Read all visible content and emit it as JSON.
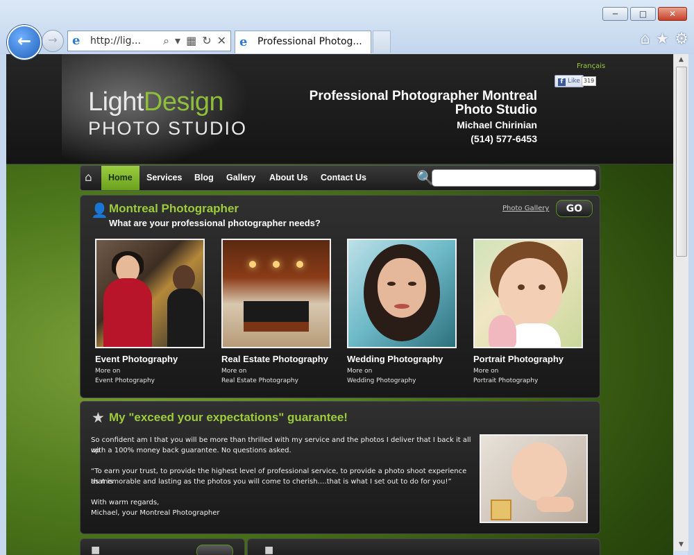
{
  "browser": {
    "address_url": "http://lig...",
    "tab_title": "Professional Photog...",
    "icons": [
      "back-icon",
      "forward-icon",
      "search-icon",
      "refresh-icon",
      "stop-icon",
      "home-icon",
      "favorites-icon",
      "tools-icon"
    ]
  },
  "header": {
    "language_link": "Français",
    "like_label": "Like",
    "like_count": "319",
    "logo_light": "Light",
    "logo_design": "Design",
    "logo_sub": "PHOTO STUDIO",
    "title_line1": "Professional Photographer Montreal",
    "title_line2": "Photo Studio",
    "name": "Michael Chirinian",
    "phone": "(514) 577-6453"
  },
  "nav": {
    "items": [
      {
        "label": "Home",
        "active": true
      },
      {
        "label": "Services"
      },
      {
        "label": "Blog"
      },
      {
        "label": "Gallery"
      },
      {
        "label": "About Us"
      },
      {
        "label": "Contact Us"
      }
    ],
    "search_value": ""
  },
  "photographer": {
    "title": "Montreal Photographer",
    "subtitle": "What are your professional photographer needs?",
    "gallery_link": "Photo Gallery",
    "go_label": "GO",
    "cards": [
      {
        "title": "Event Photography",
        "more_line1": "More on",
        "more_line2": "Event Photography"
      },
      {
        "title": "Real Estate Photography",
        "more_line1": "More on",
        "more_line2": "Real Estate Photography"
      },
      {
        "title": "Wedding Photography",
        "more_line1": "More on",
        "more_line2": "Wedding Photography"
      },
      {
        "title": "Portrait Photography",
        "more_line1": "More on",
        "more_line2": "Portrait Photography"
      }
    ]
  },
  "guarantee": {
    "title": "My \"exceed your expectations\" guarantee!",
    "para1_line1": "So confident am I that you will be more than thrilled with my service and the photos I deliver that I back it all up",
    "para1_line2": "with a 100% money back guarantee. No questions asked.",
    "para2_line1": "“To earn your trust, to provide the highest level of professional service, to provide a photo shoot experience that is",
    "para2_line2": "as memorable and lasting as the photos you will come to cherish….that is what I set out to do for you!”",
    "sign_line1": "With warm regards,",
    "sign_line2": "Michael, your Montreal Photographer"
  },
  "colors": {
    "accent_green": "#9ccc3c",
    "panel_dark": "#242424",
    "header_dark": "#1c1c1c",
    "nav_active": "#8cc63f"
  }
}
